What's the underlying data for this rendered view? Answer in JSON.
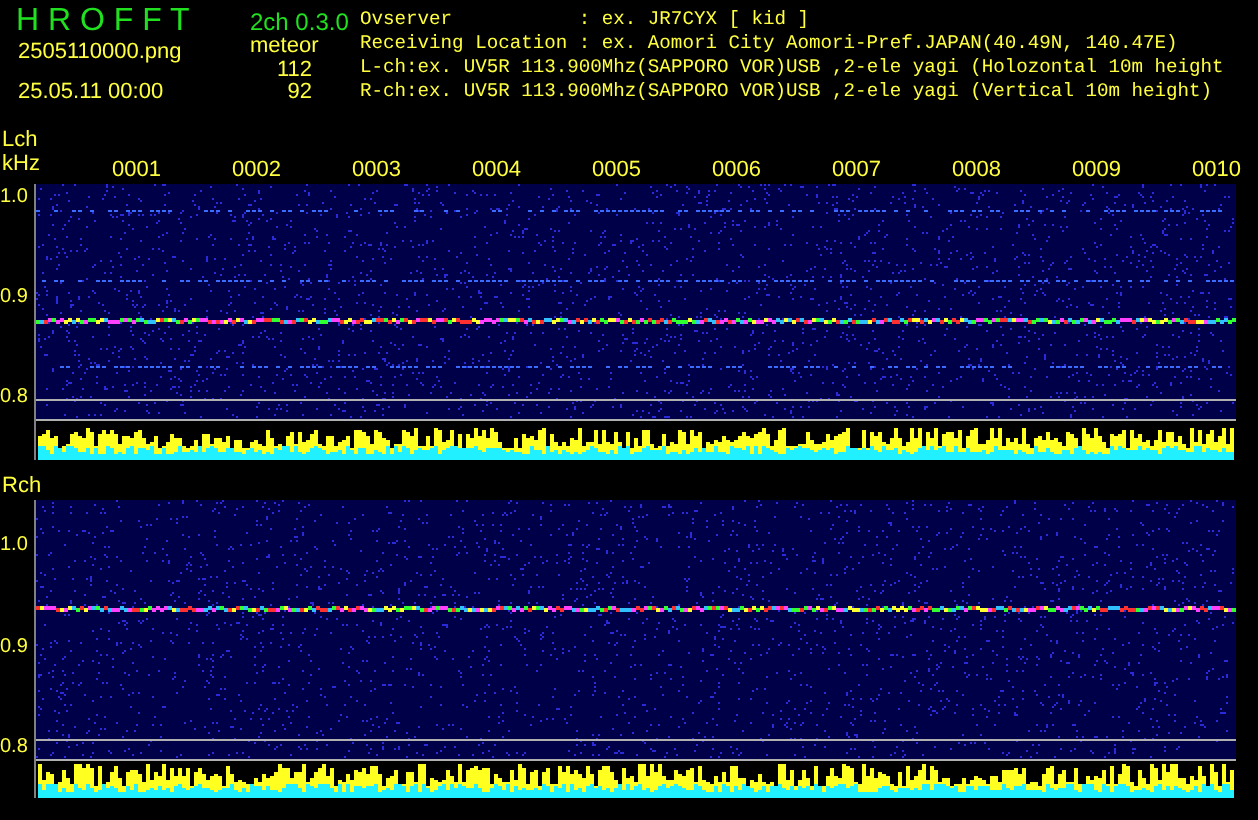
{
  "header": {
    "app_title": "H R O F F T",
    "version": "2ch 0.3.0",
    "file_name": "2505110000.png",
    "timestamp": "25.05.11 00:00",
    "meteor_label": "meteor",
    "meteor_counts": [
      "112",
      "92"
    ],
    "info": [
      {
        "kind": "field",
        "label": "Ovserver",
        "value": ": ex. JR7CYX [ kid ]"
      },
      {
        "kind": "field",
        "label": "Receiving Location",
        "value": ": ex. Aomori City Aomori-Pref.JAPAN(40.49N, 140.47E)"
      },
      {
        "kind": "line",
        "value": "L-ch:ex. UV5R 113.900Mhz(SAPPORO VOR)USB ,2-ele yagi (Holozontal 10m height"
      },
      {
        "kind": "line",
        "value": "R-ch:ex. UV5R 113.900Mhz(SAPPORO VOR)USB ,2-ele yagi (Vertical 10m height)"
      }
    ]
  },
  "channels": [
    {
      "label": "Lch",
      "unit": "kHz",
      "x_labels": [
        "0001",
        "0002",
        "0003",
        "0004",
        "0005",
        "0006",
        "0007",
        "0008",
        "0009",
        "0010"
      ],
      "y_labels": [
        "1.0",
        "0.9",
        "0.8"
      ]
    },
    {
      "label": "Rch",
      "y_labels": [
        "1.0",
        "0.9",
        "0.8"
      ]
    }
  ]
}
